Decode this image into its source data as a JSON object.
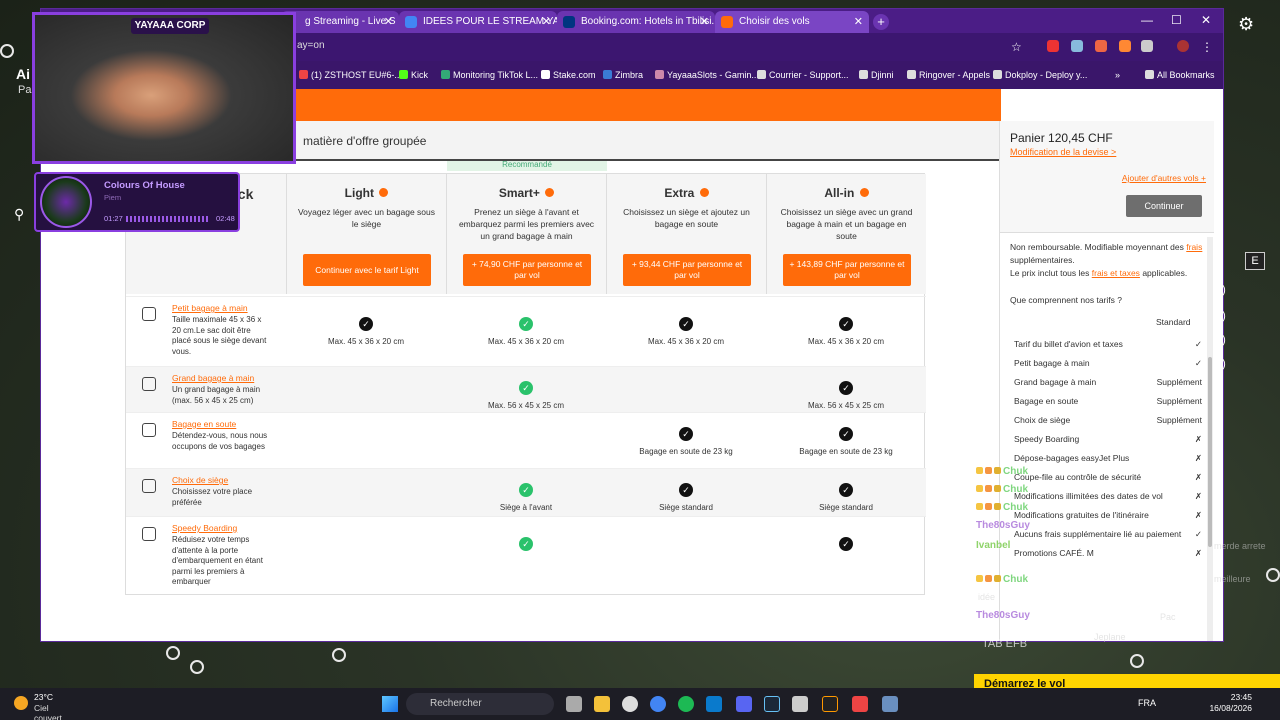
{
  "browser": {
    "tabs": [
      {
        "label": "g Streaming - Live S",
        "color": "#ff4f8b"
      },
      {
        "label": "IDEES POUR LE STREAM YAYAAA",
        "color": "#4285f4"
      },
      {
        "label": "Booking.com: Hotels in Tbilisi. B",
        "color": "#003580"
      },
      {
        "label": "Choisir des vols",
        "color": "#ff6b0a"
      }
    ],
    "url": "ay=on",
    "bookmarks": [
      {
        "label": "(1) ZSTHOST EU#6-...",
        "color": "#e44"
      },
      {
        "label": "Kick",
        "color": "#53fc18"
      },
      {
        "label": "Monitoring TikTok L...",
        "color": "#3a7"
      },
      {
        "label": "Stake.com",
        "color": "#fff"
      },
      {
        "label": "Zimbra",
        "color": "#3a7bd5"
      },
      {
        "label": "YayaaaSlots - Gamin...",
        "color": "#c8a"
      },
      {
        "label": "Courrier - Support...",
        "color": "#ddd"
      },
      {
        "label": "Djinni",
        "color": "#ddd"
      },
      {
        "label": "Ringover - Appels",
        "color": "#ddd"
      },
      {
        "label": "Dokploy - Deploy y...",
        "color": "#ddd"
      },
      {
        "label": "All Bookmarks",
        "color": "#ddd"
      }
    ],
    "chevron": "»"
  },
  "page": {
    "subheader": "matière d'offre groupée",
    "recommended": "Recommandé",
    "back_title": "ack",
    "columns": [
      {
        "title": "Light",
        "desc": "Voyagez léger avec un bagage sous le siège",
        "btn": "Continuer avec le tarif Light"
      },
      {
        "title": "Smart+",
        "desc": "Prenez un siège à l'avant et embarquez parmi les premiers avec un grand bagage à main",
        "btn": "+ 74,90 CHF par personne et par vol"
      },
      {
        "title": "Extra",
        "desc": "Choisissez un siège et ajoutez un bagage en soute",
        "btn": "+ 93,44 CHF par personne et par vol"
      },
      {
        "title": "All-in",
        "desc": "Choisissez un siège avec un grand bagage à main et un bagage en soute",
        "btn": "+ 143,89 CHF par personne et par vol"
      }
    ],
    "rows": [
      {
        "name": "Petit bagage à main",
        "desc": "Taille maximale 45 x 36 x 20 cm.Le sac doit être placé sous le siège devant vous.",
        "cells": [
          {
            "check": "black",
            "text": "Max. 45 x 36 x 20 cm"
          },
          {
            "check": "green",
            "text": "Max. 45 x 36 x 20 cm"
          },
          {
            "check": "black",
            "text": "Max. 45 x 36 x 20 cm"
          },
          {
            "check": "black",
            "text": "Max. 45 x 36 x 20 cm"
          }
        ]
      },
      {
        "name": "Grand bagage à main",
        "desc": "Un grand bagage à main (max. 56 x 45 x 25 cm)",
        "cells": [
          {
            "check": "",
            "text": ""
          },
          {
            "check": "green",
            "text": "Max. 56 x 45 x 25 cm"
          },
          {
            "check": "",
            "text": ""
          },
          {
            "check": "black",
            "text": "Max. 56 x 45 x 25 cm"
          }
        ]
      },
      {
        "name": "Bagage en soute",
        "desc": "Détendez-vous, nous nous occupons de vos bagages",
        "cells": [
          {
            "check": "",
            "text": ""
          },
          {
            "check": "",
            "text": ""
          },
          {
            "check": "black",
            "text": "Bagage en soute de 23 kg"
          },
          {
            "check": "black",
            "text": "Bagage en soute de 23 kg"
          }
        ]
      },
      {
        "name": "Choix de siège",
        "desc": "Choisissez votre place préférée",
        "cells": [
          {
            "check": "",
            "text": ""
          },
          {
            "check": "green",
            "text": "Siège à l'avant"
          },
          {
            "check": "black",
            "text": "Siège standard"
          },
          {
            "check": "black",
            "text": "Siège standard"
          }
        ]
      },
      {
        "name": "Speedy Boarding",
        "desc": "Réduisez votre temps d'attente à la porte d'embarquement en étant parmi les premiers à embarquer",
        "cells": [
          {
            "check": "",
            "text": ""
          },
          {
            "check": "green",
            "text": ""
          },
          {
            "check": "",
            "text": ""
          },
          {
            "check": "black",
            "text": ""
          }
        ]
      }
    ]
  },
  "panel": {
    "panier": "Panier 120,45 CHF",
    "devise": "Modification de la devise >",
    "autres": "Ajouter d'autres vols +",
    "continuer": "Continuer",
    "note_1": "Non remboursable. Modifiable moyennant des",
    "note_frais": "frais",
    "note_2": "supplémentaires.",
    "note_3": "Le prix inclut tous les",
    "note_frais_taxes": "frais et taxes",
    "note_4": "applicables.",
    "question": "Que comprennent nos tarifs ?",
    "standard": "Standard",
    "items": [
      {
        "label": "Tarif du billet d'avion et taxes",
        "value": "✓"
      },
      {
        "label": "Petit bagage à main",
        "value": "✓"
      },
      {
        "label": "Grand bagage à main",
        "value": "Supplément"
      },
      {
        "label": "Bagage en soute",
        "value": "Supplément"
      },
      {
        "label": "Choix de siège",
        "value": "Supplément"
      },
      {
        "label": "Speedy Boarding",
        "value": "✗"
      },
      {
        "label": "Dépose-bagages easyJet Plus",
        "value": "✗"
      },
      {
        "label": "Coupe-file au contrôle de sécurité",
        "value": "✗"
      },
      {
        "label": "Modifications illimitées des dates de vol",
        "value": "✗"
      },
      {
        "label": "Modifications gratuites de l'itinéraire",
        "value": "✗"
      },
      {
        "label": "Aucuns frais supplémentaire lié au paiement",
        "value": "✓"
      },
      {
        "label": "Promotions CAFÉ. M",
        "value": "✗"
      }
    ]
  },
  "stream": {
    "cam_title": "YAYAAA CORP",
    "song": "Colours Of House",
    "artist": "Piem",
    "time_start": "01:27",
    "time_end": "02:48",
    "chat": [
      {
        "user": "Chuk",
        "color": "#7fd67f"
      },
      {
        "user": "Chuk",
        "color": "#7fd67f"
      },
      {
        "user": "Chuk",
        "color": "#7fd67f"
      },
      {
        "user": "The80sGuy",
        "color": "#b88adf"
      },
      {
        "user": "Ivanbel",
        "color": "#8fd36a"
      },
      {
        "user": "Chuk",
        "color": "#7fd67f"
      },
      {
        "user": "The80sGuy",
        "color": "#b88adf"
      }
    ],
    "chat_faint": [
      "merde arrete",
      "meilleure",
      "idée",
      "Jeplane",
      "Pac"
    ],
    "bottom_right": "Démarrez le vol",
    "tab_efb": "TAB EFB",
    "left_ai": "Ai",
    "left_pa": "Pa"
  },
  "taskbar": {
    "temp": "23°C",
    "cond": "Ciel couvert",
    "search": "Rechercher",
    "lang": "FRA",
    "time": "23:45",
    "date": "16/08/2026"
  }
}
